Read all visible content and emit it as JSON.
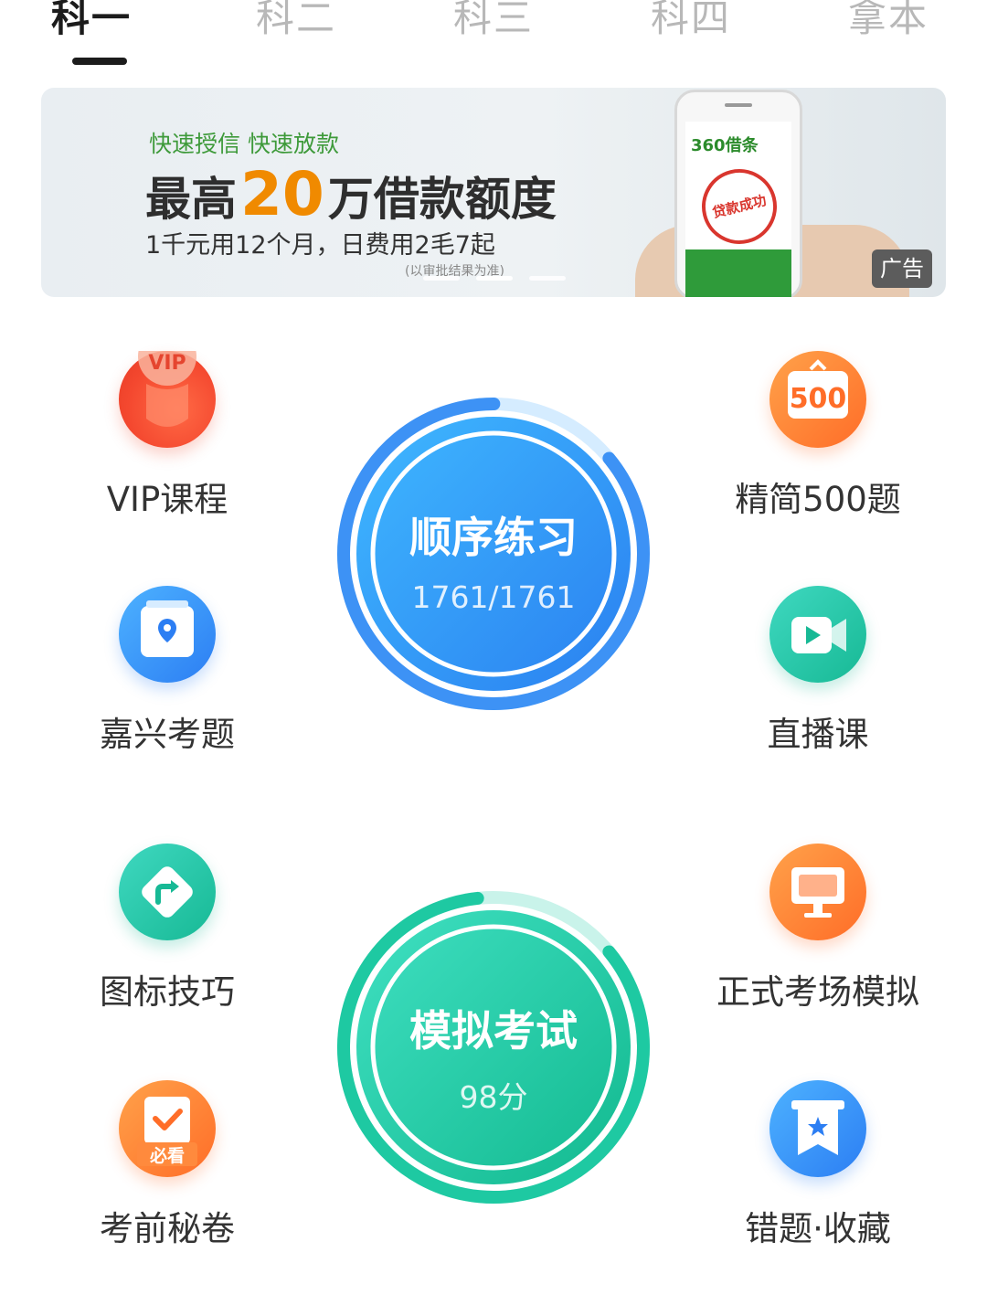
{
  "tabs": [
    {
      "label": "科一",
      "active": true
    },
    {
      "label": "科二",
      "active": false
    },
    {
      "label": "科三",
      "active": false
    },
    {
      "label": "科四",
      "active": false
    },
    {
      "label": "拿本",
      "active": false
    }
  ],
  "banner": {
    "subtitle": "快速授信 快速放款",
    "headline_pre": "最高",
    "headline_amount": "20",
    "headline_post": "万借款额度",
    "line2": "1千元用12个月，日费用2毛7起",
    "note": "(以审批结果为准)",
    "phone_brand": "360借条",
    "stamp_text": "贷款成功",
    "ad_label": "广告",
    "slide_count": 3,
    "active_slide": 2
  },
  "features_left": [
    {
      "label": "VIP课程",
      "icon": "vip-icon",
      "badge": "VIP"
    },
    {
      "label": "嘉兴考题",
      "icon": "location-card-icon"
    },
    {
      "label": "图标技巧",
      "icon": "road-sign-turn-icon"
    },
    {
      "label": "考前秘卷",
      "icon": "clipboard-check-icon",
      "badge": "必看"
    }
  ],
  "features_right": [
    {
      "label": "精简500题",
      "icon": "500-board-icon",
      "badge": "500"
    },
    {
      "label": "直播课",
      "icon": "video-play-icon"
    },
    {
      "label": "正式考场模拟",
      "icon": "monitor-icon"
    },
    {
      "label": "错题·收藏",
      "icon": "bookmark-star-icon"
    }
  ],
  "practice": {
    "title": "顺序练习",
    "progress_text": "1761/1761",
    "progress_fraction": 1.0,
    "color_start": "#3fb8ff",
    "color_end": "#2a80f0"
  },
  "exam": {
    "title": "模拟考试",
    "score_text": "98分",
    "progress_fraction": 0.98,
    "color_start": "#40e0c2",
    "color_end": "#12b98f"
  }
}
